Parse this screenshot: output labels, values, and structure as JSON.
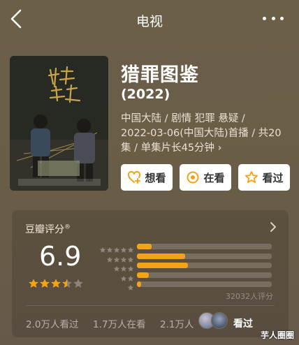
{
  "topbar": {
    "title": "电视",
    "back_icon": "chevron-left-icon",
    "more_icon": "more-dots-icon"
  },
  "show": {
    "title": "猎罪图鉴",
    "year": "(2022)",
    "meta_line1": "中国大陆 / 剧情 犯罪 悬疑 /",
    "meta_line2": "2022-03-06(中国大陆)首播 / 共20",
    "meta_line3": "集 / 单集片长45分钟",
    "meta_chevron": "›"
  },
  "actions": [
    {
      "label": "想看",
      "icon": "heart-plus-icon"
    },
    {
      "label": "在看",
      "icon": "target-circle-icon"
    },
    {
      "label": "看过",
      "icon": "star-outline-icon"
    }
  ],
  "rating": {
    "title": "豆瓣评分",
    "title_mark": "®",
    "score": "6.9",
    "score_stars": 3.5,
    "votes": "32032人评分",
    "distribution": [
      {
        "stars": 5,
        "fraction": 0.11
      },
      {
        "stars": 4,
        "fraction": 0.36
      },
      {
        "stars": 3,
        "fraction": 0.38
      },
      {
        "stars": 2,
        "fraction": 0.09
      },
      {
        "stars": 1,
        "fraction": 0.03
      }
    ],
    "watched": "2.0万人看过",
    "watching": "1.7万人在看",
    "want": "2.1万人",
    "friend_watched": "看过"
  },
  "colors": {
    "accent": "#f2a31a",
    "background": "#6a5d47"
  },
  "watermark": "芋人圈圈"
}
